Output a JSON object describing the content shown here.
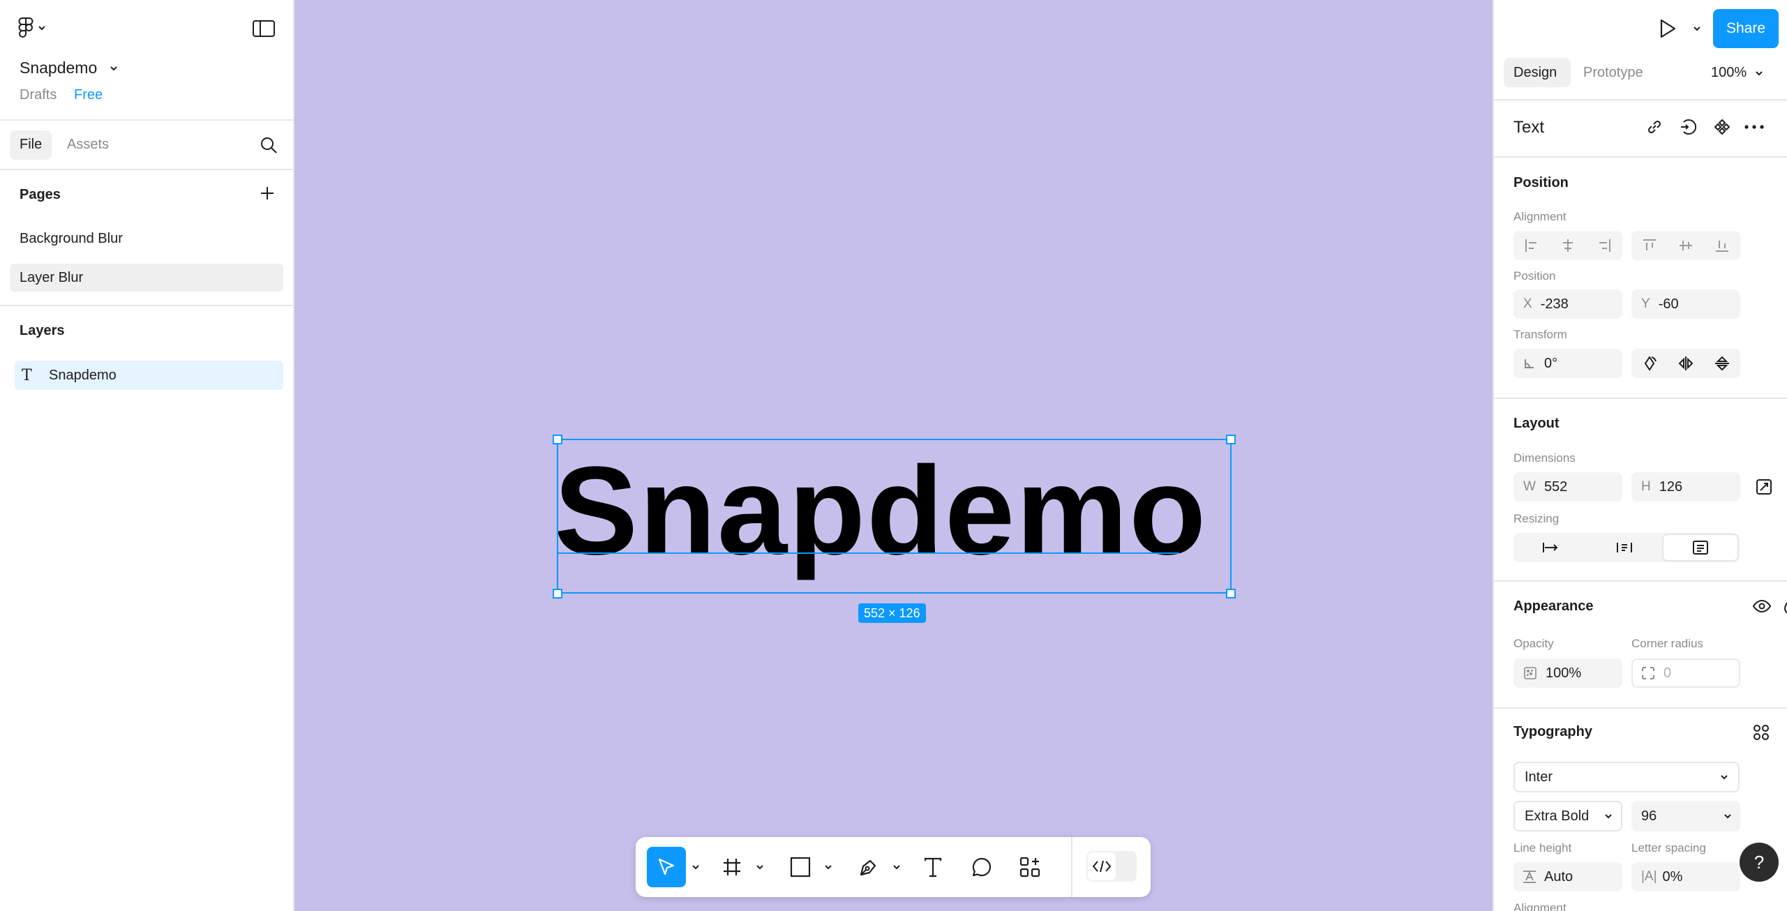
{
  "file": {
    "name": "Snapdemo",
    "location": "Drafts",
    "plan": "Free"
  },
  "left_tabs": {
    "file": "File",
    "assets": "Assets"
  },
  "pages": {
    "title": "Pages",
    "items": [
      {
        "label": "Background Blur"
      },
      {
        "label": "Layer Blur"
      }
    ]
  },
  "layers": {
    "title": "Layers",
    "items": [
      {
        "label": "Snapdemo",
        "type": "text"
      }
    ]
  },
  "canvas": {
    "text": "Snapdemo",
    "size_badge": "552 × 126",
    "background": "#c7bfeb",
    "selection_color": "#0d99ff"
  },
  "header": {
    "share": "Share"
  },
  "right_tabs": {
    "design": "Design",
    "prototype": "Prototype",
    "zoom": "100%"
  },
  "panel": {
    "title": "Text",
    "position": {
      "title": "Position",
      "alignment_label": "Alignment",
      "position_label": "Position",
      "x_prefix": "X",
      "x": "-238",
      "y_prefix": "Y",
      "y": "-60",
      "transform_label": "Transform",
      "rotation": "0°"
    },
    "layout": {
      "title": "Layout",
      "dimensions_label": "Dimensions",
      "w_prefix": "W",
      "w": "552",
      "h_prefix": "H",
      "h": "126",
      "resizing_label": "Resizing"
    },
    "appearance": {
      "title": "Appearance",
      "opacity_label": "Opacity",
      "opacity": "100%",
      "radius_label": "Corner radius",
      "radius": "0"
    },
    "typography": {
      "title": "Typography",
      "font": "Inter",
      "weight": "Extra Bold",
      "size": "96",
      "line_height_label": "Line height",
      "line_height": "Auto",
      "letter_spacing_label": "Letter spacing",
      "letter_spacing": "0%",
      "alignment_label": "Alignment"
    }
  },
  "help": "?"
}
